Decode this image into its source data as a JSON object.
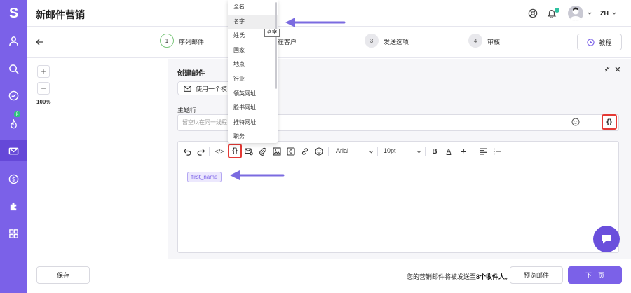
{
  "app": {
    "logo_letter": "S",
    "page_title": "新邮件营销",
    "user_initials": "ZH",
    "beta_badge": "β"
  },
  "sidebar": {
    "items": [
      {
        "icon": "user-icon",
        "active": false
      },
      {
        "icon": "search-icon",
        "active": false
      },
      {
        "icon": "check-circle-icon",
        "active": false
      },
      {
        "icon": "flame-icon",
        "active": false
      },
      {
        "icon": "mail-icon",
        "active": true
      },
      {
        "icon": "dollar-icon",
        "active": false
      },
      {
        "icon": "puzzle-icon",
        "active": false
      },
      {
        "icon": "grid-icon",
        "active": false
      }
    ]
  },
  "stepper": {
    "steps": [
      {
        "number": "1",
        "label": "序列邮件"
      },
      {
        "number": "2",
        "label": "潜在客户"
      },
      {
        "number": "3",
        "label": "发送选项"
      },
      {
        "number": "4",
        "label": "审核"
      }
    ],
    "tutorial_label": "教程"
  },
  "zoom": {
    "plus": "+",
    "minus": "−",
    "level": "100%"
  },
  "panel": {
    "title": "创建邮件",
    "template_button": "使用一个模",
    "subject_label": "主题行",
    "subject_placeholder": "留空以在同一线程",
    "variable_glyph": "{}"
  },
  "editor": {
    "font": "Arial",
    "size": "10pt",
    "bold": "B",
    "underline": "A",
    "clear": "T",
    "code": "</>",
    "chip": "first_name"
  },
  "dropdown": {
    "items": [
      "全名",
      "名字",
      "姓氏",
      "国家",
      "地点",
      "行业",
      "领英网址",
      "脸书网址",
      "推特网址",
      "职务"
    ],
    "hover_index": 1,
    "tooltip": "名字"
  },
  "footer": {
    "save": "保存",
    "message_prefix": "您的营销邮件将被发送至",
    "message_count": "8个收件人。",
    "preview": "预览邮件",
    "next": "下一页"
  },
  "colors": {
    "brand": "#7b61e8",
    "highlight": "#e53935",
    "arrow": "#7b6be0"
  }
}
